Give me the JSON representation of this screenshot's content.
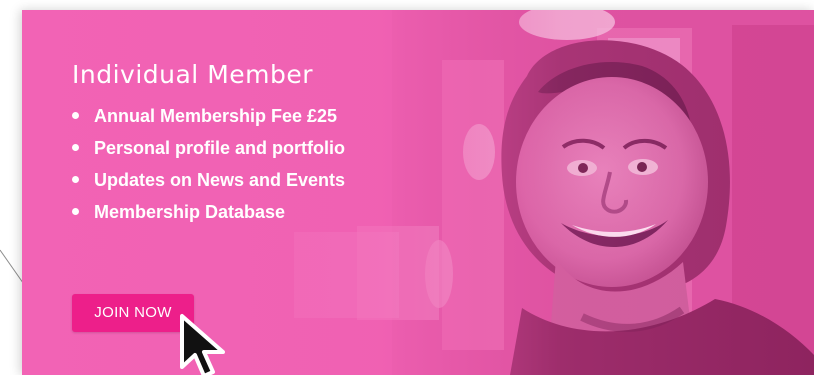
{
  "membership": {
    "title": "Individual Member",
    "features": [
      "Annual Membership Fee £25",
      "Personal profile and portfolio",
      "Updates on News and Events",
      "Membership Database"
    ],
    "cta_label": "JOIN NOW"
  },
  "colors": {
    "overlay_pink": "#ee5aab",
    "button_pink": "#ed1f8a",
    "text": "#ffffff"
  },
  "icons": {
    "cursor": "mouse-pointer-arrow-icon",
    "bullet": "bullet-dot-icon"
  }
}
